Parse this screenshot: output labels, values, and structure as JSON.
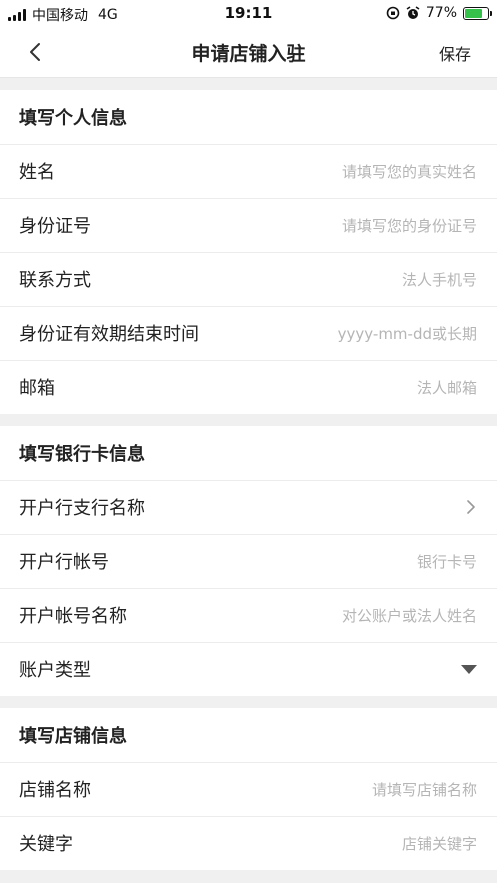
{
  "status_bar": {
    "carrier": "中国移动",
    "network": "4G",
    "time": "19:11",
    "battery_percent": "77%",
    "battery_level": 0.77,
    "battery_color": "#36c24a"
  },
  "navbar": {
    "title": "申请店铺入驻",
    "save_label": "保存"
  },
  "personal": {
    "header": "填写个人信息",
    "name_label": "姓名",
    "name_placeholder": "请填写您的真实姓名",
    "id_label": "身份证号",
    "id_placeholder": "请填写您的身份证号",
    "contact_label": "联系方式",
    "contact_placeholder": "法人手机号",
    "expiry_label": "身份证有效期结束时间",
    "expiry_placeholder": "yyyy-mm-dd或长期",
    "email_label": "邮箱",
    "email_placeholder": "法人邮箱"
  },
  "bank": {
    "header": "填写银行卡信息",
    "branch_label": "开户行支行名称",
    "account_label": "开户行帐号",
    "account_placeholder": "银行卡号",
    "account_name_label": "开户帐号名称",
    "account_name_placeholder": "对公账户或法人姓名",
    "account_type_label": "账户类型"
  },
  "store": {
    "header": "填写店铺信息",
    "store_name_label": "店铺名称",
    "store_name_placeholder": "请填写店铺名称",
    "keyword_label": "关键字",
    "keyword_placeholder": "店铺关键字"
  },
  "icons": {
    "back": "chevron-left-icon",
    "branch_arrow": "chevron-right-icon",
    "account_type_arrow": "triangle-down-icon"
  }
}
